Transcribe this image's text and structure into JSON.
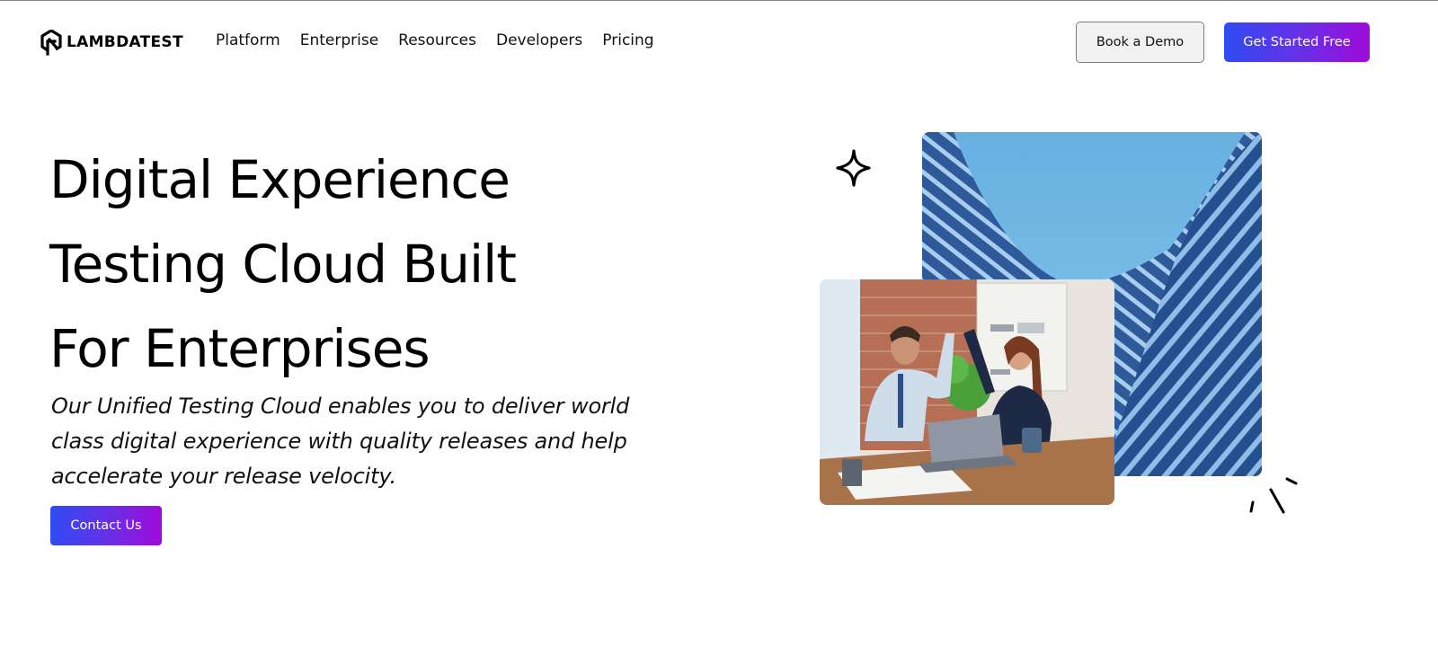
{
  "header": {
    "logo_text": "LAMBDATEST",
    "nav": [
      "Platform",
      "Enterprise",
      "Resources",
      "Developers",
      "Pricing"
    ],
    "book_demo_label": "Book a Demo",
    "get_started_label": "Get Started Free"
  },
  "hero": {
    "title_lines": [
      "Digital Experience",
      "Testing Cloud Built",
      "For Enterprises"
    ],
    "subtitle": "Our Unified Testing Cloud enables you to deliver world class digital experience with quality releases and help accelerate your release velocity.",
    "contact_label": "Contact Us"
  },
  "media": {
    "building_image": "building-facade-photo",
    "office_image": "office-high-five-photo",
    "decorations": [
      "sparkle-icon",
      "burst-lines-icon"
    ]
  },
  "colors": {
    "gradient_start": "#2f4cf2",
    "gradient_end": "#a00ad9",
    "text": "#000000",
    "demo_button_bg": "#f2f2f2"
  }
}
